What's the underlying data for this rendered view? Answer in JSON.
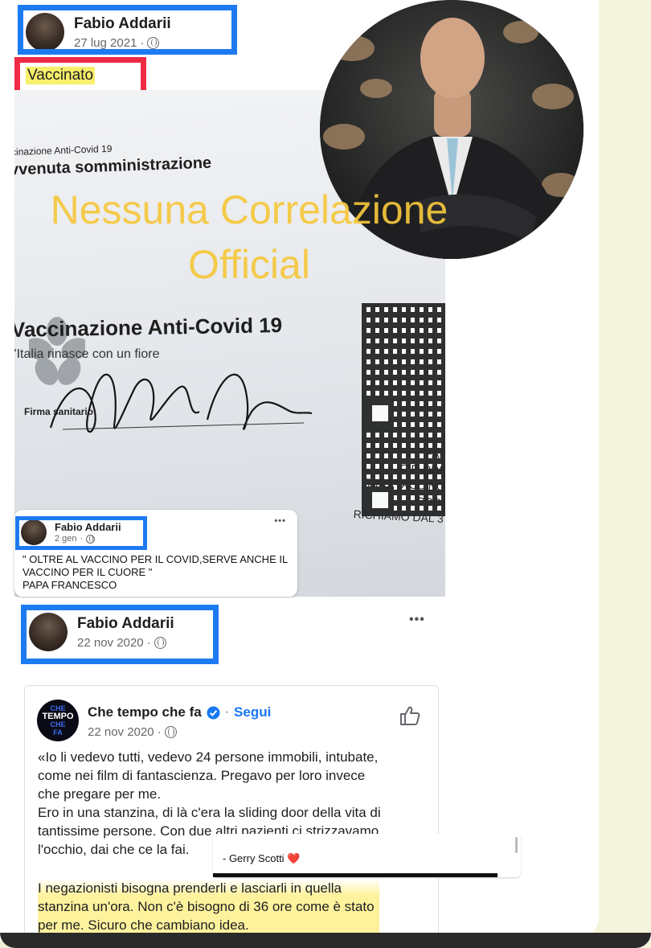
{
  "post1": {
    "author": "Fabio Addarii",
    "date": "27 lug 2021",
    "status_text": "Vaccinato"
  },
  "card": {
    "line1": "cinazione Anti-Covid 19",
    "line2": "vvenuta somministrazione",
    "title": "Vaccinazione Anti-Covid 19",
    "subtitle": "l'Italia rinasce con un fiore",
    "signature_label": "Firma sanitario",
    "right_lines": [
      "FAE",
      "C.F. DDF",
      "TIPO VACCINO",
      "CODI",
      "RICHIAMO DAL 3"
    ]
  },
  "watermark": {
    "line1": "Nessuna Correlazione",
    "line2": "Official"
  },
  "mini_comment": {
    "author": "Fabio Addarii",
    "date": "2 gen",
    "more": "•••",
    "text_line1": "\" OLTRE AL VACCINO PER IL COVID,SERVE ANCHE IL",
    "text_line2": "VACCINO PER IL CUORE \"",
    "text_line3": "PAPA FRANCESCO"
  },
  "post2": {
    "author": "Fabio Addarii",
    "date": "22 nov 2020",
    "more": "•••"
  },
  "shared": {
    "page_name": "Che tempo che fa",
    "follow": "Segui",
    "date": "22 nov 2020",
    "logo_text": [
      "CHE",
      "TEMPO",
      "CHE",
      "FA"
    ],
    "p1_lines": [
      "«Io li vedevo tutti, vedevo 24 persone immobili, intubate,",
      "come nei film di fantascienza. Pregavo per loro invece",
      "che pregare per me."
    ],
    "p2_lines": [
      "Ero in una stanzina, di là c'era la sliding door della vita di",
      "tantissime persone. Con due altri pazienti ci strizzavamo",
      "l'occhio, dai che ce la fai."
    ],
    "p3_lines": [
      "I negazionisti bisogna prenderli e lasciarli in quella",
      "stanzina un'ora. Non c'è bisogno di 36 ore come è stato",
      "per me. Sicuro che cambiano idea."
    ]
  },
  "caption": {
    "text": "- Gerry Scotti ❤️"
  },
  "colors": {
    "highlight_blue": "#1d7bf2",
    "highlight_red": "#ef2a45",
    "watermark": "#f6c83c",
    "fb_blue": "#1877f2"
  }
}
